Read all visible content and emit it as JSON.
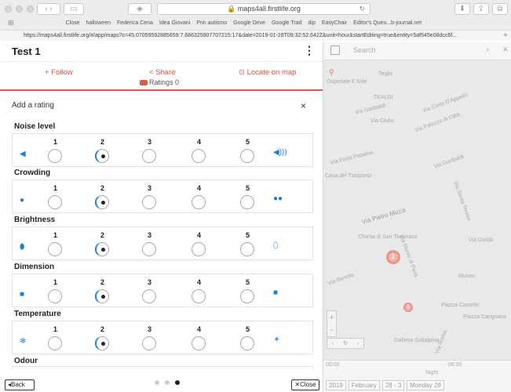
{
  "browser": {
    "address": "maps4all.firstlife.org",
    "full_url": "https://maps4all.firstlife.org/#/app/maps?c=45.07059592885659:7.686325907707215:17&date=2019-01-28T09:32:52.642Z&unit=hour&startEditing=true&entity=5af545e08dcc6f...",
    "bookmarks": [
      "Close",
      "halloween",
      "Federica Cena",
      "Idea Giovani",
      "Prin autismo",
      "Google Drive",
      "Google Trad",
      "dip",
      "EasyChair",
      "Editor's Queu...b-journal.net"
    ]
  },
  "header": {
    "title": "Test 1",
    "follow_label": "+ Follow",
    "share_label": "< Share",
    "locate_label": "⊙ Locate on map",
    "partial_tab": "Ratings 0"
  },
  "rating": {
    "heading": "Add a rating",
    "close_glyph": "×",
    "scale": [
      "1",
      "2",
      "3",
      "4",
      "5"
    ],
    "categories": [
      {
        "name": "Noise level",
        "selected": 2,
        "icon_left": "volume-low-icon",
        "icon_right": "volume-high-icon"
      },
      {
        "name": "Crowding",
        "selected": 2,
        "icon_left": "person-icon",
        "icon_right": "people-icon"
      },
      {
        "name": "Brightness",
        "selected": 2,
        "icon_left": "bulb-on-icon",
        "icon_right": "bulb-off-icon"
      },
      {
        "name": "Dimension",
        "selected": 2,
        "icon_left": "cube-small-icon",
        "icon_right": "cube-large-icon"
      },
      {
        "name": "Temperature",
        "selected": 2,
        "icon_left": "snowflake-icon",
        "icon_right": "sun-icon"
      }
    ],
    "next_category": "Odour"
  },
  "footer": {
    "back_label": "Back",
    "close_label": "Close",
    "page_dots": 3,
    "active_dot": 3
  },
  "map": {
    "search_placeholder": "Search",
    "streets": [
      "Teglie",
      "Ospedale Il Sole",
      "Via Corte D'Appello",
      "TEALDI",
      "Via Giulio",
      "Via Garibaldi",
      "Via Palazzo di Città",
      "Via Porta Palatina",
      "Via Garibaldi",
      "Casa del Trasporto",
      "Via Pietro Micca",
      "Chiesa di San Tommaso",
      "Via Santa Teresa",
      "Via Roma",
      "Via Bertola",
      "Via Monte di Pietà",
      "Via Giolitti",
      "Piazza Castello",
      "Galleria Subalpina",
      "Museo",
      "Piazza Carignano"
    ],
    "cluster_2": "2",
    "cluster_1": "1",
    "time_start": "00:00",
    "time_end": "06:00",
    "night_label": "Night",
    "date_chips": [
      "2019",
      "February",
      "28 - 3",
      "Monday 28"
    ]
  }
}
